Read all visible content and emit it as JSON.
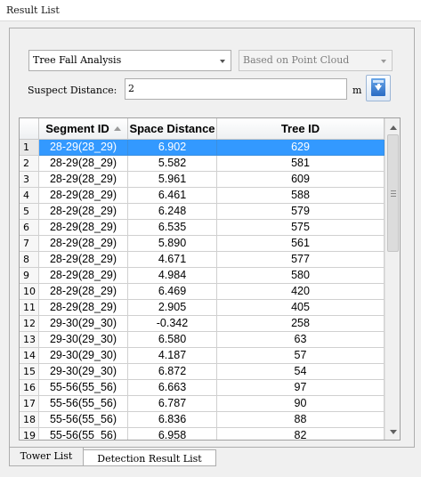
{
  "window": {
    "title": "Result List"
  },
  "controls": {
    "analysis_type": "Tree Fall Analysis",
    "method": "Based on Point Cloud",
    "distance_label": "Suspect Distance:",
    "distance_value": "2",
    "distance_unit": "m",
    "export_icon": "export-icon"
  },
  "table": {
    "columns": [
      "Segment ID",
      "Space Distance",
      "Tree ID"
    ],
    "sort_column": "Segment ID",
    "sort_direction": "ascending",
    "selected_row": 1,
    "selection_color": "#3399ff",
    "rows": [
      {
        "idx": "1",
        "segment": "28-29(28_29)",
        "distance": "6.902",
        "tree": "629"
      },
      {
        "idx": "2",
        "segment": "28-29(28_29)",
        "distance": "5.582",
        "tree": "581"
      },
      {
        "idx": "3",
        "segment": "28-29(28_29)",
        "distance": "5.961",
        "tree": "609"
      },
      {
        "idx": "4",
        "segment": "28-29(28_29)",
        "distance": "6.461",
        "tree": "588"
      },
      {
        "idx": "5",
        "segment": "28-29(28_29)",
        "distance": "6.248",
        "tree": "579"
      },
      {
        "idx": "6",
        "segment": "28-29(28_29)",
        "distance": "6.535",
        "tree": "575"
      },
      {
        "idx": "7",
        "segment": "28-29(28_29)",
        "distance": "5.890",
        "tree": "561"
      },
      {
        "idx": "8",
        "segment": "28-29(28_29)",
        "distance": "4.671",
        "tree": "577"
      },
      {
        "idx": "9",
        "segment": "28-29(28_29)",
        "distance": "4.984",
        "tree": "580"
      },
      {
        "idx": "10",
        "segment": "28-29(28_29)",
        "distance": "6.469",
        "tree": "420"
      },
      {
        "idx": "11",
        "segment": "28-29(28_29)",
        "distance": "2.905",
        "tree": "405"
      },
      {
        "idx": "12",
        "segment": "29-30(29_30)",
        "distance": "-0.342",
        "tree": "258"
      },
      {
        "idx": "13",
        "segment": "29-30(29_30)",
        "distance": "6.580",
        "tree": "63"
      },
      {
        "idx": "14",
        "segment": "29-30(29_30)",
        "distance": "4.187",
        "tree": "57"
      },
      {
        "idx": "15",
        "segment": "29-30(29_30)",
        "distance": "6.872",
        "tree": "54"
      },
      {
        "idx": "16",
        "segment": "55-56(55_56)",
        "distance": "6.663",
        "tree": "97"
      },
      {
        "idx": "17",
        "segment": "55-56(55_56)",
        "distance": "6.787",
        "tree": "90"
      },
      {
        "idx": "18",
        "segment": "55-56(55_56)",
        "distance": "6.836",
        "tree": "88"
      },
      {
        "idx": "19",
        "segment": "55-56(55_56)",
        "distance": "6.958",
        "tree": "82"
      }
    ]
  },
  "tabs": [
    {
      "label": "Tower List",
      "active": true
    },
    {
      "label": "Detection Result List",
      "active": false
    }
  ]
}
